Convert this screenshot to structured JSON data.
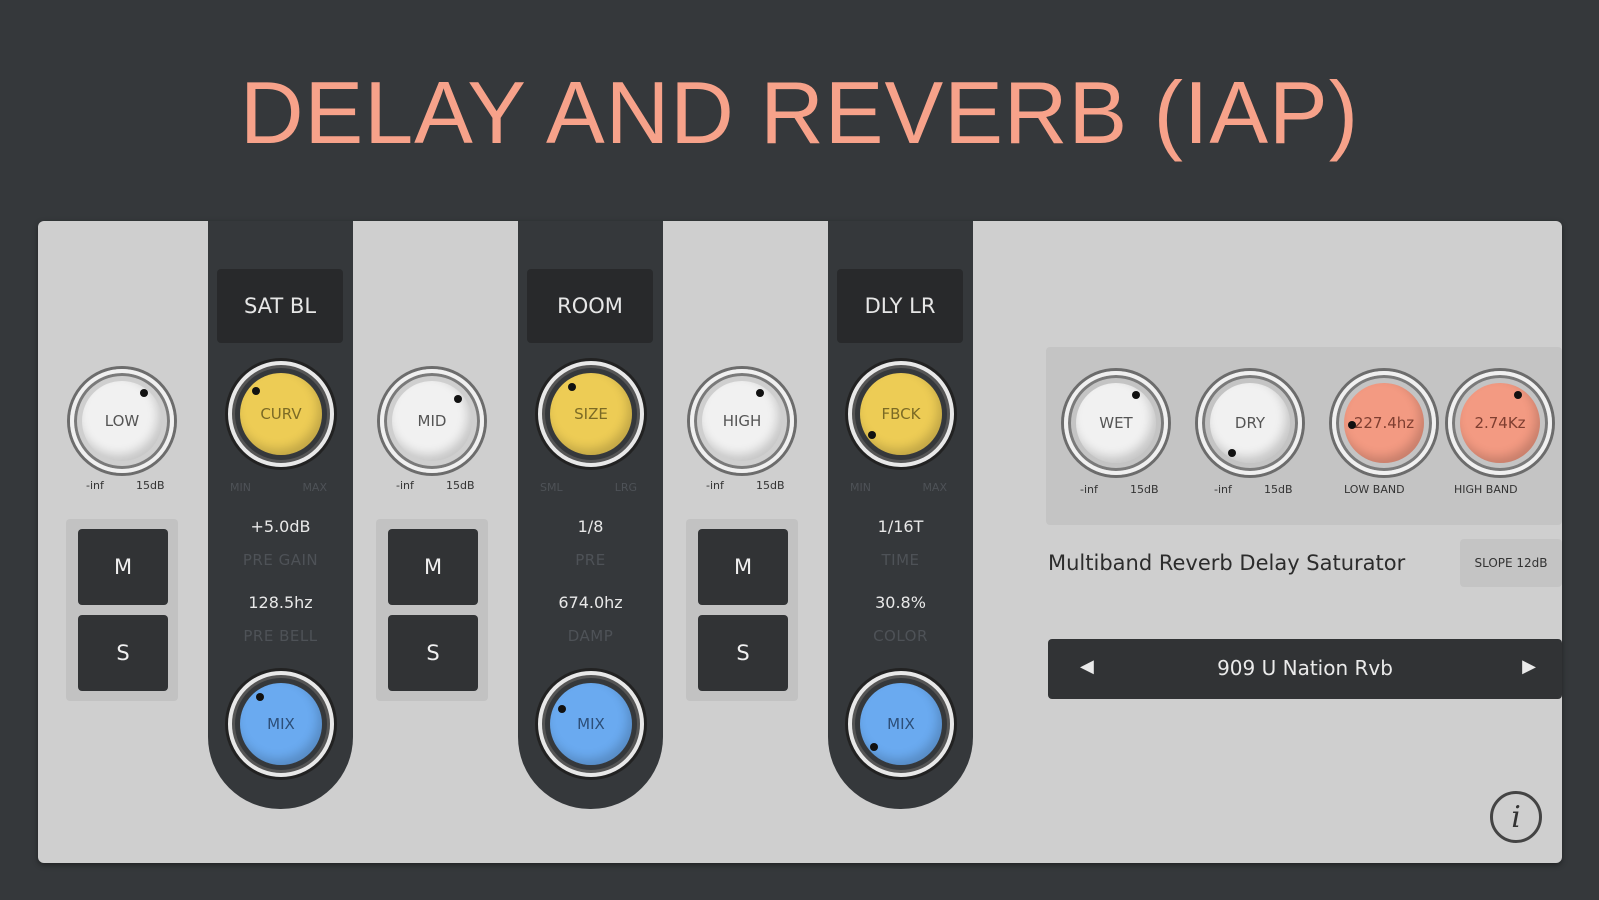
{
  "title": "DELAY AND REVERB (IAP)",
  "bands": [
    {
      "knob": "LOW",
      "min": "-inf",
      "max": "15dB",
      "mute": "M",
      "solo": "S"
    },
    {
      "knob": "MID",
      "min": "-inf",
      "max": "15dB",
      "mute": "M",
      "solo": "S"
    },
    {
      "knob": "HIGH",
      "min": "-inf",
      "max": "15dB",
      "mute": "M",
      "solo": "S"
    }
  ],
  "strips": [
    {
      "label": "SAT BL",
      "knob": "CURV",
      "knob_min": "MIN",
      "knob_max": "MAX",
      "val1": "+5.0dB",
      "cap1": "PRE GAIN",
      "val2": "128.5hz",
      "cap2": "PRE BELL",
      "mix": "MIX"
    },
    {
      "label": "ROOM",
      "knob": "SIZE",
      "knob_min": "SML",
      "knob_max": "LRG",
      "val1": "1/8",
      "cap1": "PRE",
      "val2": "674.0hz",
      "cap2": "DAMP",
      "mix": "MIX"
    },
    {
      "label": "DLY LR",
      "knob": "FBCK",
      "knob_min": "MIN",
      "knob_max": "MAX",
      "val1": "1/16T",
      "cap1": "TIME",
      "val2": "30.8%",
      "cap2": "COLOR",
      "mix": "MIX"
    }
  ],
  "output": {
    "wet": {
      "label": "WET",
      "min": "-inf",
      "max": "15dB"
    },
    "dry": {
      "label": "DRY",
      "min": "-inf",
      "max": "15dB"
    },
    "low_band": {
      "value": "227.4hz",
      "caption": "LOW BAND"
    },
    "high_band": {
      "value": "2.74Kz",
      "caption": "HIGH BAND"
    }
  },
  "product_name": "Multiband Reverb Delay Saturator",
  "slope": "SLOPE 12dB",
  "preset": {
    "name": "909 U Nation Rvb",
    "prev": "◀",
    "next": "▶"
  },
  "info": "i",
  "colors": {
    "accent": "#f7a28a",
    "yellow": "#edcc55",
    "blue": "#6aaaf0",
    "salmon": "#f39a82"
  }
}
